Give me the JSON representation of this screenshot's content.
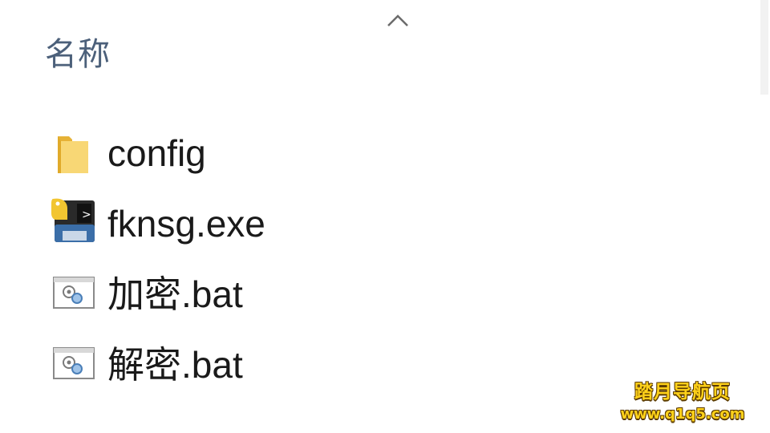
{
  "header": {
    "column_name": "名称",
    "sort_icon": "chevron-up-icon"
  },
  "files": [
    {
      "name": "config",
      "icon": "folder-icon"
    },
    {
      "name": "fknsg.exe",
      "icon": "python-exe-icon"
    },
    {
      "name": "加密.bat",
      "icon": "batch-file-icon"
    },
    {
      "name": "解密.bat",
      "icon": "batch-file-icon"
    }
  ],
  "watermark": {
    "title": "踏月导航页",
    "url": "www.q1q5.com"
  },
  "colors": {
    "header_text": "#4c607a",
    "folder": "#f5c84a",
    "watermark": "#ffd21a"
  }
}
